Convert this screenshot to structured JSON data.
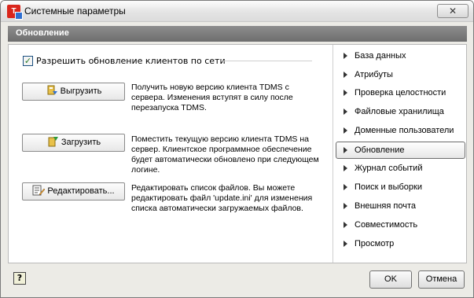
{
  "window": {
    "title": "Системные параметры",
    "close_glyph": "✕"
  },
  "section": {
    "title": "Обновление"
  },
  "main": {
    "allow_update_checkbox": {
      "label": "Разрешить обновление клиентов по сети",
      "checked": true
    },
    "actions": [
      {
        "button_label": "Выгрузить",
        "icon": "export-icon",
        "description": "Получить новую версию клиента TDMS с сервера. Изменения вступят в силу после перезапуска TDMS."
      },
      {
        "button_label": "Загрузить",
        "icon": "import-icon",
        "description": "Поместить текущую версию клиента TDMS на сервер. Клиентское программное обеспечение будет автоматически обновлено при следующем логине."
      },
      {
        "button_label": "Редактировать...",
        "icon": "edit-list-icon",
        "description": "Редактировать список файлов. Вы можете редактировать файл 'update.ini' для изменения списка автоматически загружаемых файлов."
      }
    ]
  },
  "nav": {
    "items": [
      {
        "label": "База данных"
      },
      {
        "label": "Атрибуты"
      },
      {
        "label": "Проверка целостности"
      },
      {
        "label": "Файловые хранилища"
      },
      {
        "label": "Доменные пользователи"
      },
      {
        "label": "Обновление",
        "active": true
      },
      {
        "label": "Журнал событий"
      },
      {
        "label": "Поиск и выборки"
      },
      {
        "label": "Внешняя почта"
      },
      {
        "label": "Совместимость"
      },
      {
        "label": "Просмотр"
      }
    ]
  },
  "footer": {
    "help_glyph": "?",
    "ok_label": "OK",
    "cancel_label": "Отмена"
  }
}
